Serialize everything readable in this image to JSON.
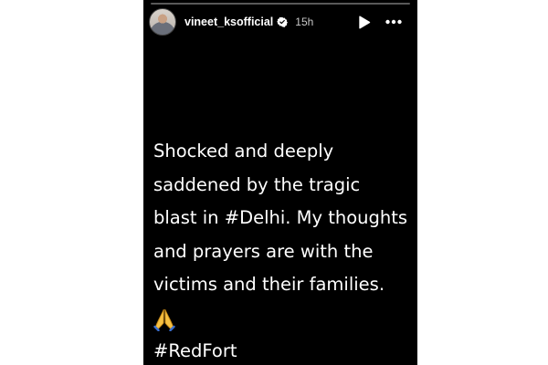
{
  "story": {
    "username": "vineet_ksofficial",
    "time_ago": "15h",
    "progress": 0,
    "caption_lines": [
      "Shocked and deeply",
      "saddened by the tragic",
      "blast in #Delhi. My thoughts",
      "and prayers are with the",
      "victims and their families."
    ],
    "emoji": "🙏",
    "hashtag": "#RedFort"
  },
  "icons": {
    "verified": "verified-badge-icon",
    "play": "play-icon",
    "more": "more-options-icon",
    "emoji": "folded-hands-emoji"
  },
  "colors": {
    "story_background": "#000000",
    "text": "#ffffff",
    "timestamp": "#c8c8c8",
    "page_background": "#ffffff"
  }
}
